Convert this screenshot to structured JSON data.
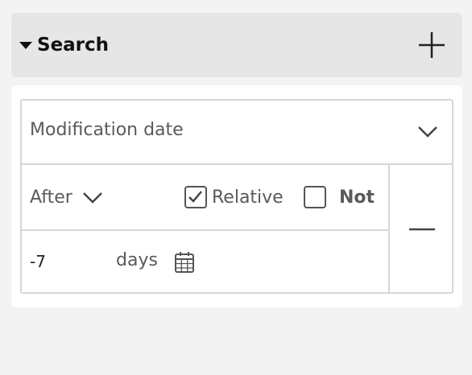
{
  "search": {
    "title": "Search",
    "icons": {
      "toggle": "caret-down-icon",
      "add": "plus-icon"
    }
  },
  "filter": {
    "field": {
      "label": "Modification date",
      "icon": "chevron-down-icon"
    },
    "operator": {
      "label": "After",
      "icon": "chevron-down-icon"
    },
    "relative": {
      "label": "Relative",
      "checked": true
    },
    "not": {
      "label": "Not",
      "checked": false
    },
    "value": "-7",
    "unit": "days",
    "icons": {
      "calendar": "calendar-icon",
      "remove": "minus-icon"
    }
  }
}
